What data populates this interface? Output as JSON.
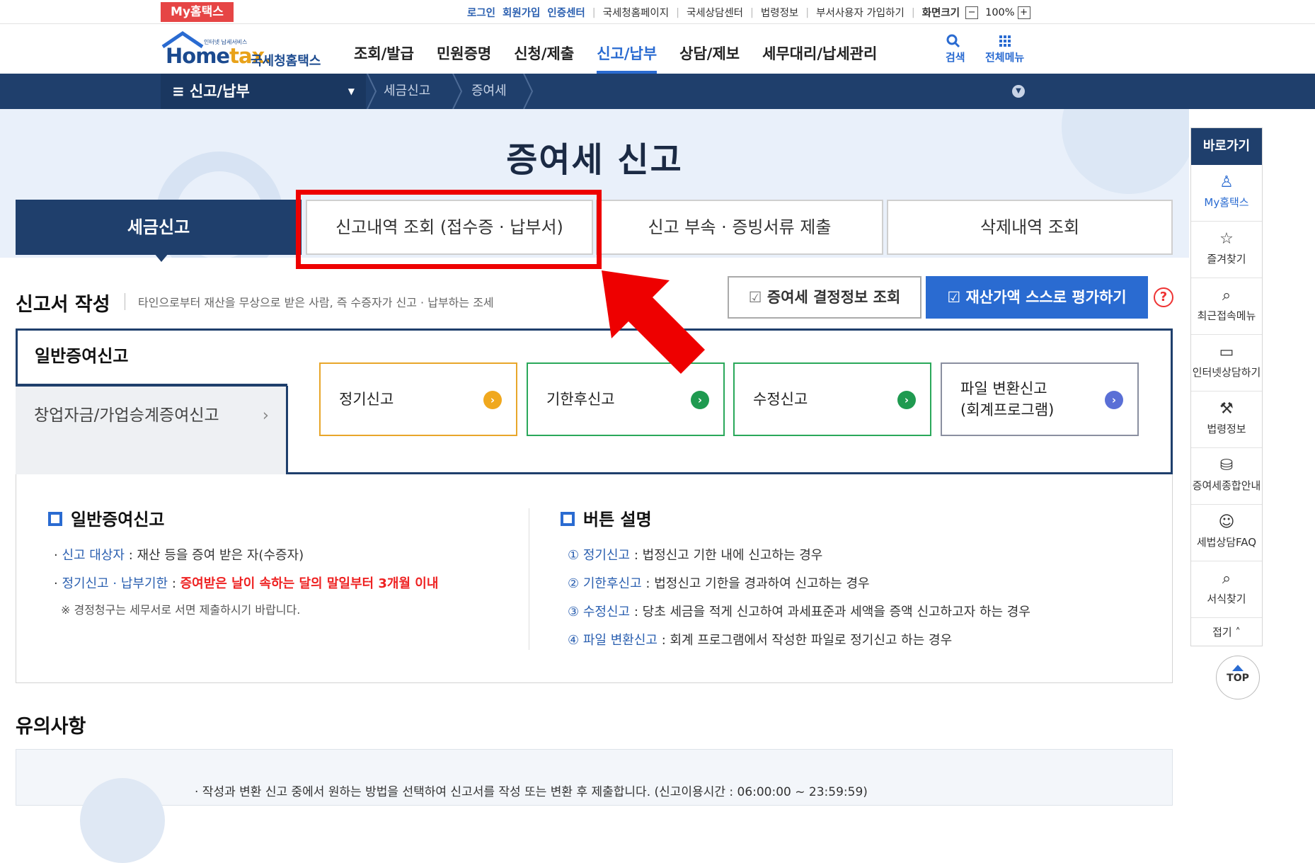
{
  "utility": {
    "my_badge": "My홈택스",
    "login": "로그인",
    "signup": "회원가입",
    "cert_center": "인증센터",
    "nts_home": "국세청홈페이지",
    "consult_center": "국세상담센터",
    "law_info": "법령정보",
    "dept_signup": "부서사용자 가입하기",
    "screen_size_label": "화면크기",
    "zoom_minus": "−",
    "zoom": "100%",
    "zoom_plus": "+"
  },
  "header": {
    "logo_home": "Home",
    "logo_tax": "tax.",
    "logo_kr": "국세청홈택스",
    "logo_tiny": "인터넷 납세서비스",
    "gnb": [
      "조회/발급",
      "민원증명",
      "신청/제출",
      "신고/납부",
      "상담/제보",
      "세무대리/납세관리"
    ],
    "active_gnb": "신고/납부",
    "search_label": "검색",
    "all_menu_label": "전체메뉴"
  },
  "navbar": {
    "menu_label": "≡  신고/납부",
    "crumb1": "세금신고",
    "crumb2": "증여세"
  },
  "hero": {
    "title": "증여세 신고"
  },
  "tabs": [
    "세금신고",
    "신고내역 조회 (접수증 · 납부서)",
    "신고 부속 · 증빙서류 제출",
    "삭제내역 조회"
  ],
  "section": {
    "title": "신고서 작성",
    "desc": "타인으로부터 재산을 무상으로 받은 사람, 즉 수증자가 신고 · 납부하는 조세",
    "btn_info": "증여세 결정정보 조회",
    "btn_eval": "재산가액 스스로 평가하기",
    "help": "?"
  },
  "panel": {
    "item1": "일반증여신고",
    "item2": "창업자금/가업승계증여신고",
    "item2_arrow": "›",
    "buttons": [
      {
        "label": "정기신고",
        "icon": "›"
      },
      {
        "label": "기한후신고",
        "icon": "›"
      },
      {
        "label": "수정신고",
        "icon": "›"
      },
      {
        "label": "파일 변환신고\n(회계프로그램)",
        "icon": "›"
      }
    ]
  },
  "desc_left": {
    "title": "일반증여신고",
    "l1_key": "신고 대상자",
    "l1_val": " : 재산 등을 증여 받은 자(수증자)",
    "l2_key": "정기신고 · 납부기한",
    "l2_sep": " : ",
    "l2_val": "증여받은 날이 속하는 달의 말일부터 3개월 이내",
    "l3": "※ 경정청구는 세무서로 서면 제출하시기 바랍니다."
  },
  "desc_right": {
    "title": "버튼 설명",
    "items": [
      {
        "num": "①",
        "key": "정기신고",
        "val": " : 법정신고 기한 내에 신고하는 경우"
      },
      {
        "num": "②",
        "key": "기한후신고",
        "val": " : 법정신고 기한을 경과하여 신고하는 경우"
      },
      {
        "num": "③",
        "key": "수정신고",
        "val": " : 당초 세금을 적게 신고하여 과세표준과 세액을 증액 신고하고자 하는 경우"
      },
      {
        "num": "④",
        "key": "파일 변환신고",
        "val": " : 회계 프로그램에서 작성한 파일로 정기신고 하는 경우"
      }
    ]
  },
  "caution": {
    "title": "유의사항",
    "line": "· 작성과 변환 신고 중에서 원하는 방법을 선택하여 신고서를 작성 또는 변환 후 제출합니다. (신고이용시간 : 06:00:00 ~ 23:59:59)"
  },
  "quick": {
    "title": "바로가기",
    "items": [
      "My홈택스",
      "즐겨찾기",
      "최근접속메뉴",
      "인터넷상담하기",
      "법령정보",
      "증여세종합안내",
      "세법상담FAQ",
      "서식찾기"
    ],
    "fold": "접기 ˄",
    "top": "TOP"
  },
  "colors": {
    "navy": "#1f3f6c",
    "accent_blue": "#2a6bd1",
    "highlight_red": "#ee0000"
  }
}
